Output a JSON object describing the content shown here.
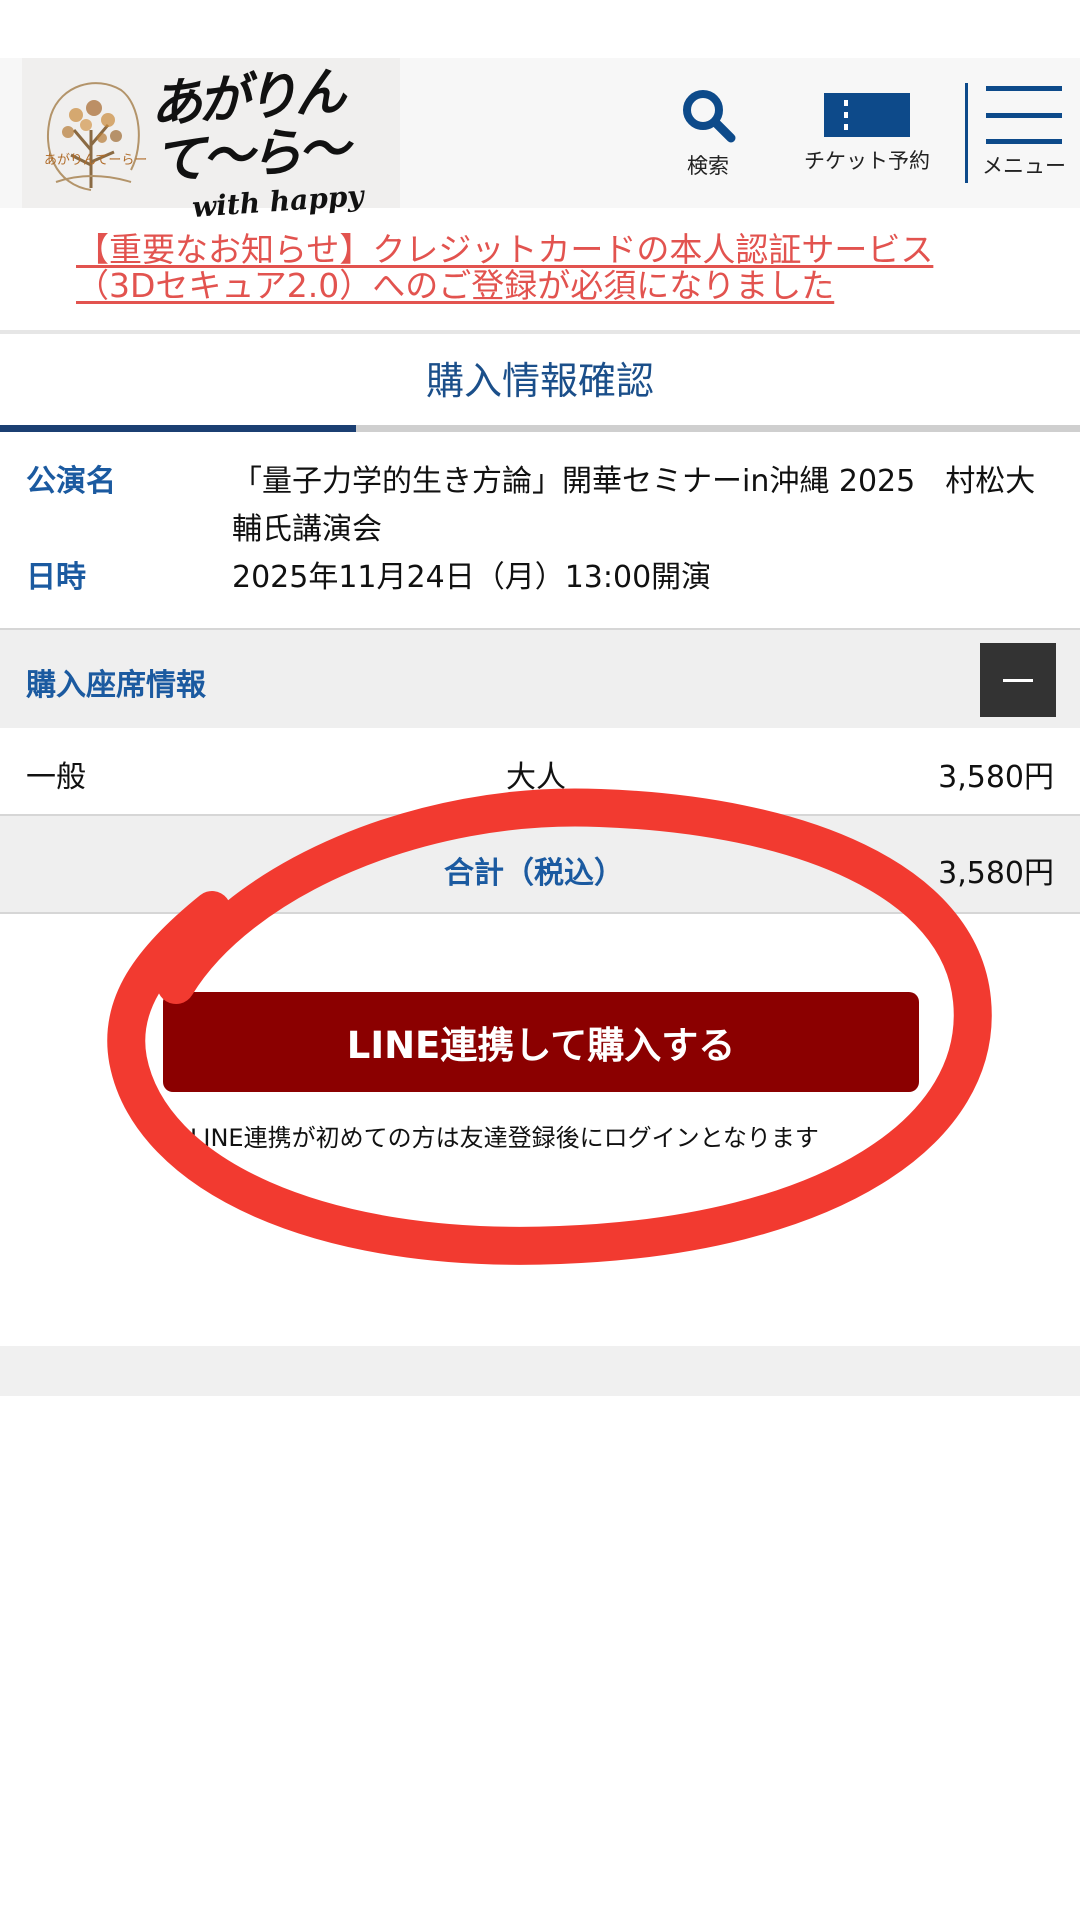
{
  "header": {
    "logo": {
      "script_line1": "あがりんて〜ら〜",
      "script_line2": "with happy",
      "small_text": "あがりんてーらー"
    },
    "nav": {
      "search_label": "検索",
      "ticket_label": "チケット予約",
      "menu_label": "メニュー"
    }
  },
  "notice": {
    "text": "【重要なお知らせ】クレジットカードの本人認証サービス（3Dセキュア2.0）へのご登録が必須になりました"
  },
  "page": {
    "title": "購入情報確認",
    "progress_fraction": 0.33
  },
  "performance": {
    "name_label": "公演名",
    "name_value": "「量子力学的生き方論」開華セミナーin沖縄 2025　村松大輔氏講演会",
    "datetime_label": "日時",
    "datetime_value": "2025年11月24日（月）13:00開演"
  },
  "seats": {
    "title": "購入座席情報",
    "collapse_symbol": "—",
    "rows": [
      {
        "seat_type": "一般",
        "category": "大人",
        "price": "3,580円"
      }
    ],
    "total_label": "合計（税込）",
    "total_value": "3,580円"
  },
  "purchase": {
    "button_label": "LINE連携して購入する",
    "note": "LINE連携が初めての方は友達登録後にログインとなります"
  },
  "colors": {
    "brand_blue": "#1b5aa0",
    "button_red": "#8b0000",
    "notice_red": "#e2534f",
    "annotation_red": "#f23a30"
  }
}
